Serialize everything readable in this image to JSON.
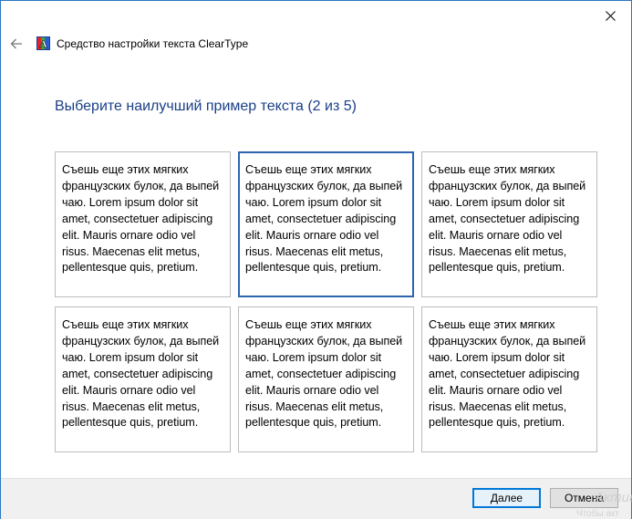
{
  "window": {
    "title": "Средство настройки текста ClearType",
    "accent": "#2b78c2"
  },
  "heading": "Выберите наилучший пример текста (2 из 5)",
  "samples": [
    {
      "text": "Съешь еще этих мягких французских булок, да выпей чаю. Lorem ipsum dolor sit amet, consectetuer adipiscing elit. Mauris ornare odio vel risus. Maecenas elit metus, pellentesque quis, pretium.",
      "selected": false
    },
    {
      "text": "Съешь еще этих мягких французских булок, да выпей чаю. Lorem ipsum dolor sit amet, consectetuer adipiscing elit. Mauris ornare odio vel risus. Maecenas elit metus, pellentesque quis, pretium.",
      "selected": true
    },
    {
      "text": "Съешь еще этих мягких французских булок, да выпей чаю. Lorem ipsum dolor sit amet, consectetuer adipiscing elit. Mauris ornare odio vel risus. Maecenas elit metus, pellentesque quis, pretium.",
      "selected": false
    },
    {
      "text": "Съешь еще этих мягких французских булок, да выпей чаю. Lorem ipsum dolor sit amet, consectetuer adipiscing elit. Mauris ornare odio vel risus. Maecenas elit metus, pellentesque quis, pretium.",
      "selected": false
    },
    {
      "text": "Съешь еще этих мягких французских булок, да выпей чаю. Lorem ipsum dolor sit amet, consectetuer adipiscing elit. Mauris ornare odio vel risus. Maecenas elit metus, pellentesque quis, pretium.",
      "selected": false
    },
    {
      "text": "Съешь еще этих мягких французских булок, да выпей чаю. Lorem ipsum dolor sit amet, consectetuer adipiscing elit. Mauris ornare odio vel risus. Maecenas elit metus, pellentesque quis, pretium.",
      "selected": false
    }
  ],
  "buttons": {
    "next_label": "Далее",
    "cancel_label": "Отмена"
  },
  "watermark": {
    "line1": "Актива",
    "line2": "Чтобы акт"
  },
  "icons": {
    "back": "back-arrow-icon",
    "close": "close-icon",
    "app": "cleartype-icon"
  }
}
